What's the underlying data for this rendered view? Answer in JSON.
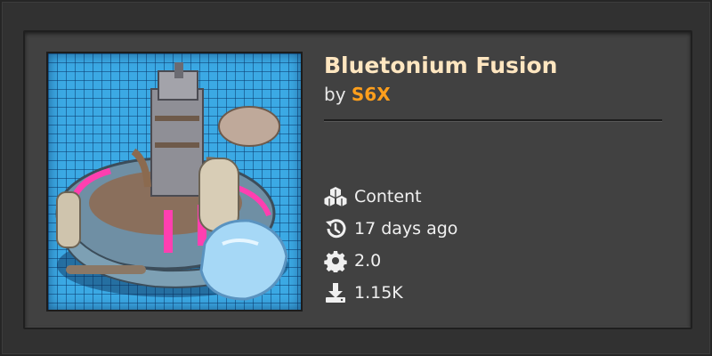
{
  "mod": {
    "title": "Bluetonium Fusion",
    "by_label": "by",
    "author": "S6X"
  },
  "stats": [
    {
      "icon": "cubes-icon",
      "label": "Content"
    },
    {
      "icon": "history-icon",
      "label": "17 days ago"
    },
    {
      "icon": "gear-icon",
      "label": "2.0"
    },
    {
      "icon": "download-icon",
      "label": "1.15K"
    }
  ],
  "colors": {
    "title": "#ffe6c0",
    "author": "#ff9f1c",
    "card_bg": "#414141",
    "thumb_bg": "#3ba9e4"
  }
}
